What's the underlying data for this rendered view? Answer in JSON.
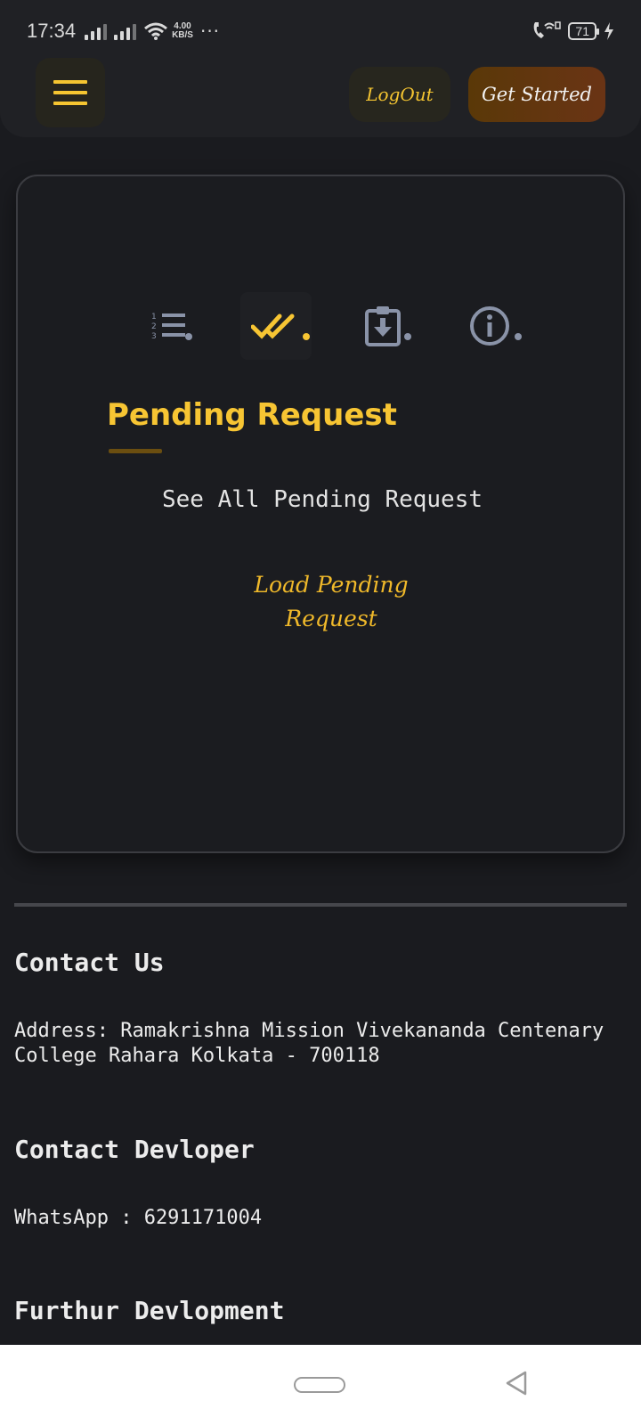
{
  "status_bar": {
    "time": "17:34",
    "net_speed_value": "4.00",
    "net_speed_unit": "KB/S",
    "more": "···",
    "battery": "71"
  },
  "header": {
    "menu_icon": "hamburger-menu-icon",
    "logout_label": "LogOut",
    "get_started_label": "Get Started"
  },
  "card": {
    "tabs": [
      {
        "icon": "numbered-list-icon",
        "active": false
      },
      {
        "icon": "double-check-icon",
        "active": true
      },
      {
        "icon": "clipboard-download-icon",
        "active": false
      },
      {
        "icon": "info-icon",
        "active": false
      }
    ],
    "title": "Pending Request",
    "subtitle": "See All Pending Request",
    "load_line1": "Load Pending",
    "load_line2": "Request"
  },
  "footer": {
    "contact_heading": "Contact Us",
    "address_line1": "Address: Ramakrishna Mission Vivekananda Centenary",
    "address_line2": "College Rahara Kolkata - 700118",
    "developer_heading": "Contact Devloper",
    "whatsapp": "WhatsApp : 6291171004",
    "further_heading": "Furthur Devlopment"
  },
  "colors": {
    "accent": "#f7c533",
    "background": "#1a1b1f",
    "icon_gray": "#8a93a8"
  }
}
